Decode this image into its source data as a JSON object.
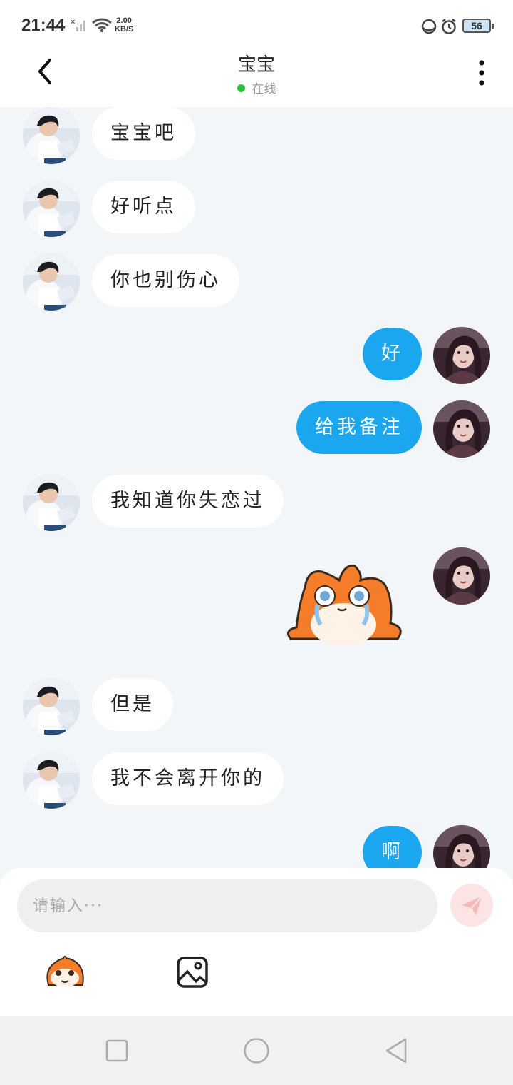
{
  "status_bar": {
    "time": "21:44",
    "net_speed_value": "2.00",
    "net_speed_unit": "KB/S",
    "battery": "56"
  },
  "header": {
    "title": "宝宝",
    "status": "在线"
  },
  "messages": [
    {
      "side": "in",
      "type": "text",
      "text": "宝宝吧"
    },
    {
      "side": "in",
      "type": "text",
      "text": "好听点"
    },
    {
      "side": "in",
      "type": "text",
      "text": "你也别伤心"
    },
    {
      "side": "out",
      "type": "text",
      "text": "好"
    },
    {
      "side": "out",
      "type": "text",
      "text": "给我备注"
    },
    {
      "side": "in",
      "type": "text",
      "text": "我知道你失恋过"
    },
    {
      "side": "out",
      "type": "sticker",
      "sticker": "crying-fox-sticker"
    },
    {
      "side": "in",
      "type": "text",
      "text": "但是"
    },
    {
      "side": "in",
      "type": "text",
      "text": "我不会离开你的"
    },
    {
      "side": "out",
      "type": "text",
      "text": "啊"
    }
  ],
  "input": {
    "placeholder": "请输入···"
  },
  "colors": {
    "outgoing_bubble": "#1aa7f0",
    "incoming_bubble": "#ffffff",
    "chat_background": "#f3f6f8",
    "online_dot": "#2bc23e",
    "send_button": "#fde4e4"
  },
  "icons": {
    "back": "chevron-left-icon",
    "more": "more-vertical-icon",
    "send": "paper-plane-icon",
    "emoji": "monkey-emoji-icon",
    "image": "image-icon",
    "nav_recent": "square-icon",
    "nav_home": "circle-icon",
    "nav_back": "triangle-back-icon"
  }
}
